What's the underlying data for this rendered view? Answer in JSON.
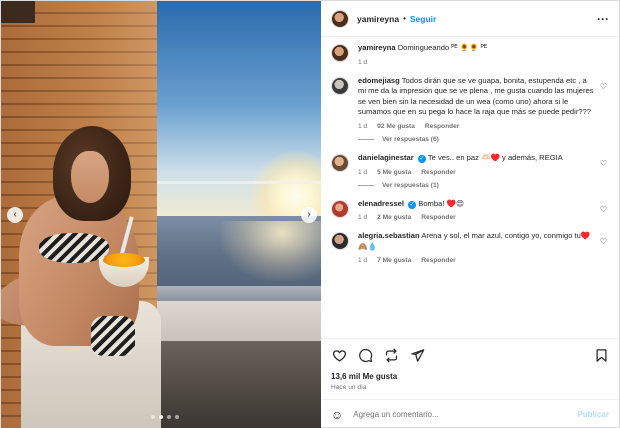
{
  "post": {
    "author": "yamireyna",
    "follow_label": "Seguir",
    "more_label": "···",
    "separator": "•",
    "caption": "Domingueando ᴾᴱ 🌻🌻 ᴾᴱ",
    "caption_time": "1 d"
  },
  "media": {
    "prev_label": "‹",
    "next_label": "›",
    "slides": 4,
    "active_slide": 2
  },
  "comments": [
    {
      "username": "edomejiasg",
      "verified": false,
      "text": "Todos dirán que se ve guapa, bonita, estupenda etc , a mi me da la impresión que se ve plena , me gusta cuando las mujeres se ven bien sin la necesidad de un wea (como uno) ahora si le sumamos que en su pega lo hace la raja que más se puede pedir???",
      "time": "1 d",
      "likes": "92 Me gusta",
      "reply_label": "Responder",
      "replies": "Ver respuestas (6)"
    },
    {
      "username": "danielaginestar",
      "verified": true,
      "text": "Te ves.. en paz 🫶🏻♥️ y además, REGIA",
      "time": "1 d",
      "likes": "5 Me gusta",
      "reply_label": "Responder",
      "replies": "Ver respuestas (1)"
    },
    {
      "username": "elenadressel",
      "verified": true,
      "text": "Bomba! ♥️😍",
      "time": "1 d",
      "likes": "2 Me gusta",
      "reply_label": "Responder",
      "replies": ""
    },
    {
      "username": "alegria.sebastian",
      "verified": false,
      "text": "Arena y sol, el mar azul, contigo yo, conmigo tu♥️🙈💧",
      "time": "1 d",
      "likes": "7 Me gusta",
      "reply_label": "Responder",
      "replies": ""
    }
  ],
  "engagement": {
    "likes": "13,6 mil Me gusta",
    "time": "Hace un día"
  },
  "composer": {
    "placeholder": "Agrega un comentario...",
    "publish_label": "Publicar",
    "emoji_icon": "☺"
  },
  "icons": {
    "heart": "♡",
    "verified": "✓"
  },
  "colors": {
    "accent": "#0095f6",
    "publish_disabled": "#b3dbff",
    "muted": "#737373"
  }
}
